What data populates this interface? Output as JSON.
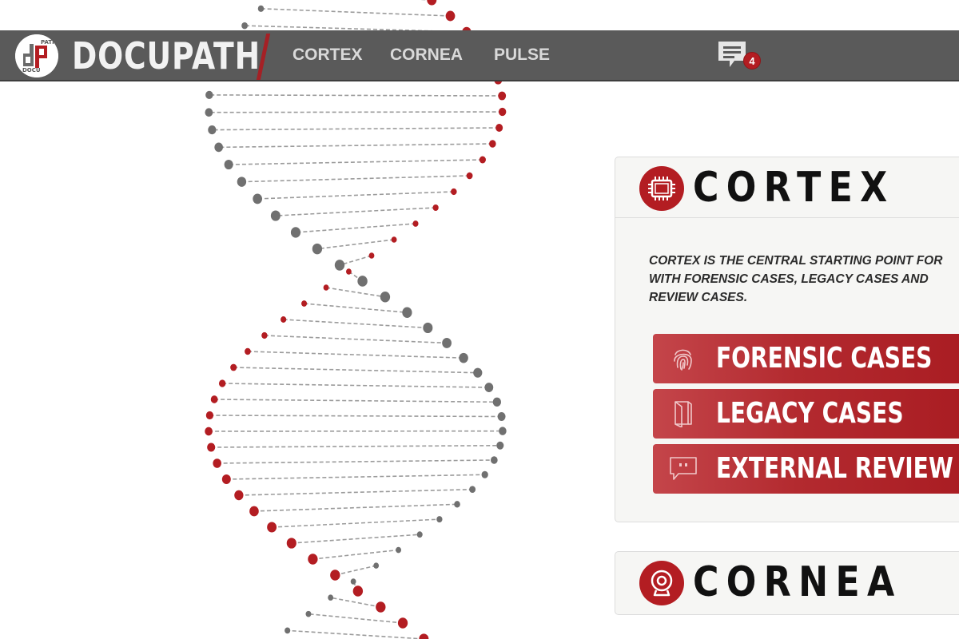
{
  "app": {
    "brand": "DOCUPATH",
    "logo_text_top": "PATH",
    "logo_text_bottom": "DOCU"
  },
  "nav": [
    {
      "label": "CORTEX"
    },
    {
      "label": "CORNEA"
    },
    {
      "label": "PULSE"
    }
  ],
  "messages": {
    "icon": "chat-bubble-icon",
    "count": "4"
  },
  "colors": {
    "accent": "#b31d22",
    "topbar": "#5a5a5a",
    "helix_red": "#b31d22",
    "helix_gray": "#707070"
  },
  "cortex": {
    "title": "CORTEX",
    "icon": "chip-icon",
    "description_lines": [
      "CORTEX IS THE CENTRAL STARTING POINT FOR",
      "WITH FORENSIC CASES, LEGACY CASES AND",
      "REVIEW CASES."
    ],
    "buttons": [
      {
        "label": "FORENSIC CASES",
        "icon": "fingerprint-icon"
      },
      {
        "label": "LEGACY CASES",
        "icon": "folder-icon"
      },
      {
        "label": "EXTERNAL REVIEW CASES",
        "icon": "comment-icon"
      }
    ]
  },
  "cornea": {
    "title": "CORNEA",
    "icon": "webcam-icon"
  }
}
